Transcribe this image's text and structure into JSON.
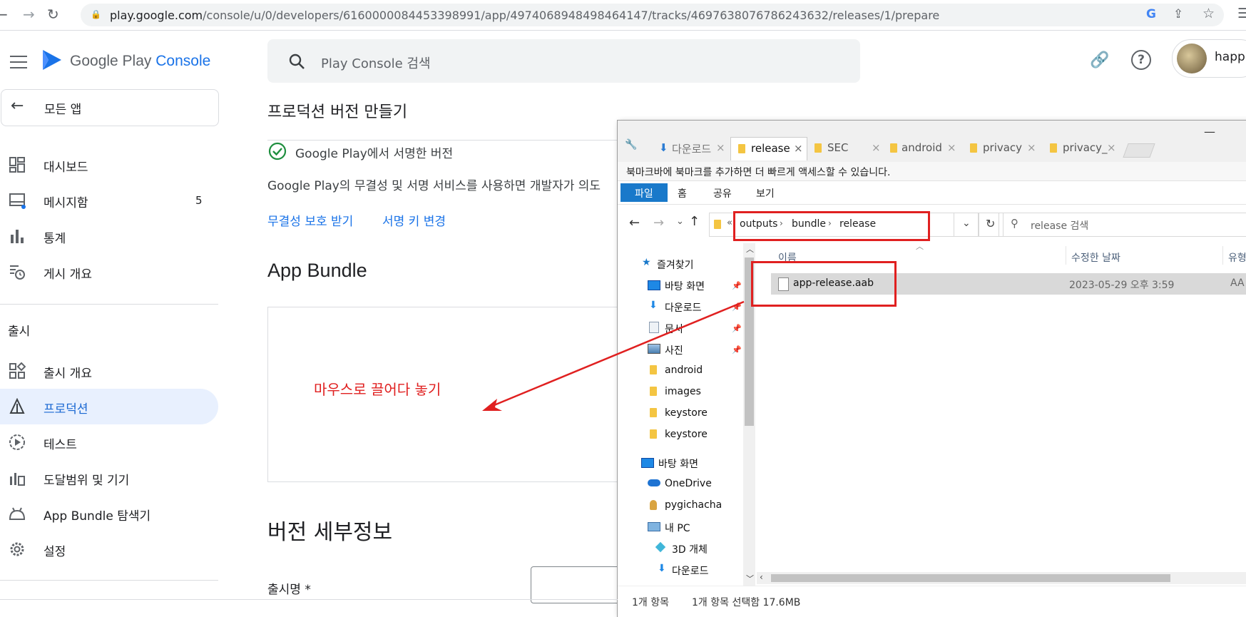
{
  "browser": {
    "url_host": "play.google.com",
    "url_path": "/console/u/0/developers/6160000084453398991/app/4974068948498464147/tracks/4697638076786243632/releases/1/prepare"
  },
  "header": {
    "app_name_google_play": "Google Play",
    "app_name_console": "Console",
    "search_placeholder": "Play Console 검색",
    "account_name": "happ"
  },
  "sidebar": {
    "back_label": "모든 앱",
    "items": [
      {
        "label": "대시보드"
      },
      {
        "label": "메시지함",
        "badge": "5"
      },
      {
        "label": "통계"
      },
      {
        "label": "게시 개요"
      }
    ],
    "section_label": "출시",
    "release_items": [
      {
        "label": "출시 개요"
      },
      {
        "label": "프로덕션"
      },
      {
        "label": "테스트"
      },
      {
        "label": "도달범위 및 기기"
      },
      {
        "label": "App Bundle 탐색기"
      },
      {
        "label": "설정"
      }
    ]
  },
  "main": {
    "page_title": "프로덕션 버전 만들기",
    "signing_label": "Google Play에서 서명한 버전",
    "signing_desc": "Google Play의 무결성 및 서명 서비스를 사용하면 개발자가 의도",
    "link_integrity": "무결성 보호 받기",
    "link_change_key": "서명 키 변경",
    "app_bundle_heading": "App Bundle",
    "drag_annotation": "마우스로 끌어다 놓기",
    "version_details_heading": "버전 세부정보",
    "release_name_label": "출시명 *"
  },
  "explorer": {
    "tabs": [
      {
        "label": "다운로드"
      },
      {
        "label": "release"
      },
      {
        "label": "SEC"
      },
      {
        "label": "android"
      },
      {
        "label": "privacy"
      },
      {
        "label": "privacy_"
      }
    ],
    "bookmark_hint": "북마크바에 북마크를 추가하면 더 빠르게 액세스할 수 있습니다.",
    "ribbon": [
      "파일",
      "홈",
      "공유",
      "보기"
    ],
    "breadcrumb": {
      "prefix": "«",
      "parts": [
        "outputs",
        "bundle",
        "release"
      ]
    },
    "search_placeholder": "release 검색",
    "tree": {
      "quick_access": "즐겨찾기",
      "quick_items": [
        {
          "label": "바탕 화면"
        },
        {
          "label": "다운로드"
        },
        {
          "label": "문서"
        },
        {
          "label": "사진"
        },
        {
          "label": "android"
        },
        {
          "label": "images"
        },
        {
          "label": "keystore"
        },
        {
          "label": "keystore"
        }
      ],
      "desktop": "바탕 화면",
      "onedrive": "OneDrive",
      "user": "pygichacha",
      "this_pc": "내 PC",
      "objects3d": "3D 개체",
      "downloads": "다운로드"
    },
    "columns": {
      "name": "이름",
      "modified": "수정한 날짜",
      "type": "유형"
    },
    "files": [
      {
        "name": "app-release.aab",
        "modified": "2023-05-29 오후 3:59",
        "type": "AA"
      }
    ],
    "status_count": "1개 항목",
    "status_selected": "1개 항목 선택함 17.6MB"
  }
}
